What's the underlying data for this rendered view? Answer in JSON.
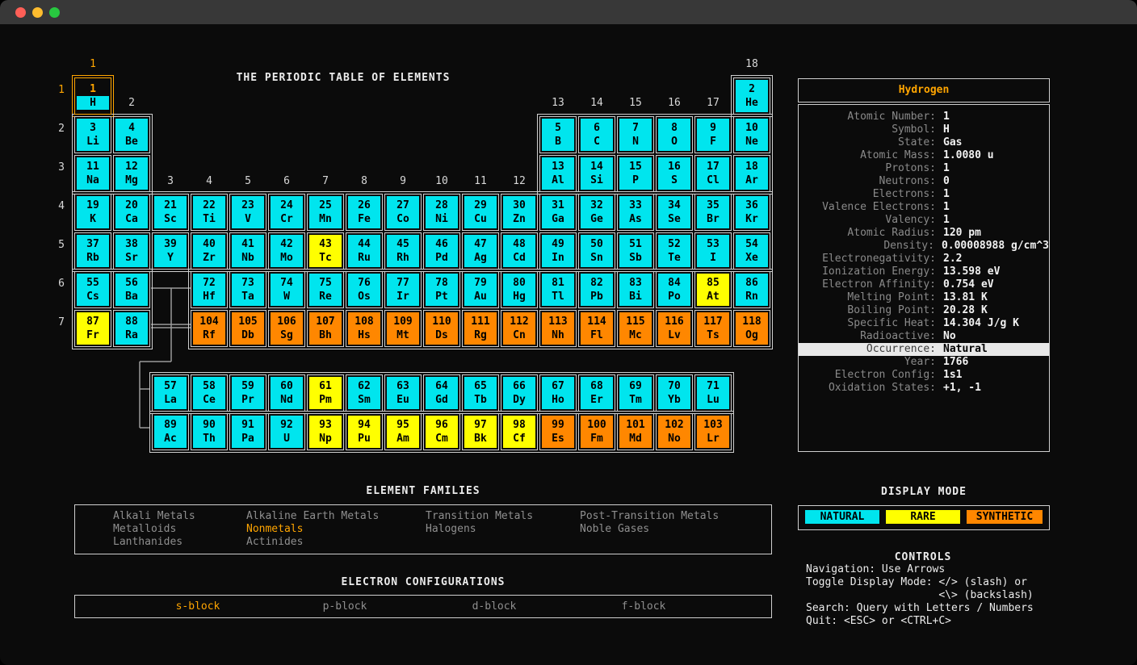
{
  "colors": {
    "natural": "#00e5ee",
    "rare": "#ffff00",
    "synthetic": "#ff8700",
    "accent": "#ffa500",
    "background": "#0b0b0b",
    "border": "#cfcfcf"
  },
  "table": {
    "title": "THE PERIODIC TABLE OF ELEMENTS",
    "selected_atomic_number": 1,
    "group_labels": [
      {
        "label": "1",
        "col": 1,
        "band": "top",
        "highlight": true
      },
      {
        "label": "2",
        "col": 2,
        "band": "row1"
      },
      {
        "label": "3",
        "col": 3,
        "band": "row3"
      },
      {
        "label": "4",
        "col": 4,
        "band": "row3"
      },
      {
        "label": "5",
        "col": 5,
        "band": "row3"
      },
      {
        "label": "6",
        "col": 6,
        "band": "row3"
      },
      {
        "label": "7",
        "col": 7,
        "band": "row3"
      },
      {
        "label": "8",
        "col": 8,
        "band": "row3"
      },
      {
        "label": "9",
        "col": 9,
        "band": "row3"
      },
      {
        "label": "10",
        "col": 10,
        "band": "row3"
      },
      {
        "label": "11",
        "col": 11,
        "band": "row3"
      },
      {
        "label": "12",
        "col": 12,
        "band": "row3"
      },
      {
        "label": "13",
        "col": 13,
        "band": "row1"
      },
      {
        "label": "14",
        "col": 14,
        "band": "row1"
      },
      {
        "label": "15",
        "col": 15,
        "band": "row1"
      },
      {
        "label": "16",
        "col": 16,
        "band": "row1"
      },
      {
        "label": "17",
        "col": 17,
        "band": "row1"
      },
      {
        "label": "18",
        "col": 18,
        "band": "top"
      }
    ],
    "period_labels": [
      {
        "label": "1",
        "highlight": true
      },
      {
        "label": "2"
      },
      {
        "label": "3"
      },
      {
        "label": "4"
      },
      {
        "label": "5"
      },
      {
        "label": "6"
      },
      {
        "label": "7"
      }
    ],
    "element_fields": [
      "atomic_number",
      "symbol",
      "grid_column",
      "grid_row",
      "occurrence(N=natural,R=rare,S=synthetic)"
    ],
    "elements": [
      [
        1,
        "H",
        1,
        1,
        "N"
      ],
      [
        2,
        "He",
        18,
        1,
        "N"
      ],
      [
        3,
        "Li",
        1,
        2,
        "N"
      ],
      [
        4,
        "Be",
        2,
        2,
        "N"
      ],
      [
        5,
        "B",
        13,
        2,
        "N"
      ],
      [
        6,
        "C",
        14,
        2,
        "N"
      ],
      [
        7,
        "N",
        15,
        2,
        "N"
      ],
      [
        8,
        "O",
        16,
        2,
        "N"
      ],
      [
        9,
        "F",
        17,
        2,
        "N"
      ],
      [
        10,
        "Ne",
        18,
        2,
        "N"
      ],
      [
        11,
        "Na",
        1,
        3,
        "N"
      ],
      [
        12,
        "Mg",
        2,
        3,
        "N"
      ],
      [
        13,
        "Al",
        13,
        3,
        "N"
      ],
      [
        14,
        "Si",
        14,
        3,
        "N"
      ],
      [
        15,
        "P",
        15,
        3,
        "N"
      ],
      [
        16,
        "S",
        16,
        3,
        "N"
      ],
      [
        17,
        "Cl",
        17,
        3,
        "N"
      ],
      [
        18,
        "Ar",
        18,
        3,
        "N"
      ],
      [
        19,
        "K",
        1,
        4,
        "N"
      ],
      [
        20,
        "Ca",
        2,
        4,
        "N"
      ],
      [
        21,
        "Sc",
        3,
        4,
        "N"
      ],
      [
        22,
        "Ti",
        4,
        4,
        "N"
      ],
      [
        23,
        "V",
        5,
        4,
        "N"
      ],
      [
        24,
        "Cr",
        6,
        4,
        "N"
      ],
      [
        25,
        "Mn",
        7,
        4,
        "N"
      ],
      [
        26,
        "Fe",
        8,
        4,
        "N"
      ],
      [
        27,
        "Co",
        9,
        4,
        "N"
      ],
      [
        28,
        "Ni",
        10,
        4,
        "N"
      ],
      [
        29,
        "Cu",
        11,
        4,
        "N"
      ],
      [
        30,
        "Zn",
        12,
        4,
        "N"
      ],
      [
        31,
        "Ga",
        13,
        4,
        "N"
      ],
      [
        32,
        "Ge",
        14,
        4,
        "N"
      ],
      [
        33,
        "As",
        15,
        4,
        "N"
      ],
      [
        34,
        "Se",
        16,
        4,
        "N"
      ],
      [
        35,
        "Br",
        17,
        4,
        "N"
      ],
      [
        36,
        "Kr",
        18,
        4,
        "N"
      ],
      [
        37,
        "Rb",
        1,
        5,
        "N"
      ],
      [
        38,
        "Sr",
        2,
        5,
        "N"
      ],
      [
        39,
        "Y",
        3,
        5,
        "N"
      ],
      [
        40,
        "Zr",
        4,
        5,
        "N"
      ],
      [
        41,
        "Nb",
        5,
        5,
        "N"
      ],
      [
        42,
        "Mo",
        6,
        5,
        "N"
      ],
      [
        43,
        "Tc",
        7,
        5,
        "R"
      ],
      [
        44,
        "Ru",
        8,
        5,
        "N"
      ],
      [
        45,
        "Rh",
        9,
        5,
        "N"
      ],
      [
        46,
        "Pd",
        10,
        5,
        "N"
      ],
      [
        47,
        "Ag",
        11,
        5,
        "N"
      ],
      [
        48,
        "Cd",
        12,
        5,
        "N"
      ],
      [
        49,
        "In",
        13,
        5,
        "N"
      ],
      [
        50,
        "Sn",
        14,
        5,
        "N"
      ],
      [
        51,
        "Sb",
        15,
        5,
        "N"
      ],
      [
        52,
        "Te",
        16,
        5,
        "N"
      ],
      [
        53,
        "I",
        17,
        5,
        "N"
      ],
      [
        54,
        "Xe",
        18,
        5,
        "N"
      ],
      [
        55,
        "Cs",
        1,
        6,
        "N"
      ],
      [
        56,
        "Ba",
        2,
        6,
        "N"
      ],
      [
        72,
        "Hf",
        4,
        6,
        "N"
      ],
      [
        73,
        "Ta",
        5,
        6,
        "N"
      ],
      [
        74,
        "W",
        6,
        6,
        "N"
      ],
      [
        75,
        "Re",
        7,
        6,
        "N"
      ],
      [
        76,
        "Os",
        8,
        6,
        "N"
      ],
      [
        77,
        "Ir",
        9,
        6,
        "N"
      ],
      [
        78,
        "Pt",
        10,
        6,
        "N"
      ],
      [
        79,
        "Au",
        11,
        6,
        "N"
      ],
      [
        80,
        "Hg",
        12,
        6,
        "N"
      ],
      [
        81,
        "Tl",
        13,
        6,
        "N"
      ],
      [
        82,
        "Pb",
        14,
        6,
        "N"
      ],
      [
        83,
        "Bi",
        15,
        6,
        "N"
      ],
      [
        84,
        "Po",
        16,
        6,
        "N"
      ],
      [
        85,
        "At",
        17,
        6,
        "R"
      ],
      [
        86,
        "Rn",
        18,
        6,
        "N"
      ],
      [
        87,
        "Fr",
        1,
        7,
        "R"
      ],
      [
        88,
        "Ra",
        2,
        7,
        "N"
      ],
      [
        104,
        "Rf",
        4,
        7,
        "S"
      ],
      [
        105,
        "Db",
        5,
        7,
        "S"
      ],
      [
        106,
        "Sg",
        6,
        7,
        "S"
      ],
      [
        107,
        "Bh",
        7,
        7,
        "S"
      ],
      [
        108,
        "Hs",
        8,
        7,
        "S"
      ],
      [
        109,
        "Mt",
        9,
        7,
        "S"
      ],
      [
        110,
        "Ds",
        10,
        7,
        "S"
      ],
      [
        111,
        "Rg",
        11,
        7,
        "S"
      ],
      [
        112,
        "Cn",
        12,
        7,
        "S"
      ],
      [
        113,
        "Nh",
        13,
        7,
        "S"
      ],
      [
        114,
        "Fl",
        14,
        7,
        "S"
      ],
      [
        115,
        "Mc",
        15,
        7,
        "S"
      ],
      [
        116,
        "Lv",
        16,
        7,
        "S"
      ],
      [
        117,
        "Ts",
        17,
        7,
        "S"
      ],
      [
        118,
        "Og",
        18,
        7,
        "S"
      ],
      [
        57,
        "La",
        3,
        8,
        "N"
      ],
      [
        58,
        "Ce",
        4,
        8,
        "N"
      ],
      [
        59,
        "Pr",
        5,
        8,
        "N"
      ],
      [
        60,
        "Nd",
        6,
        8,
        "N"
      ],
      [
        61,
        "Pm",
        7,
        8,
        "R"
      ],
      [
        62,
        "Sm",
        8,
        8,
        "N"
      ],
      [
        63,
        "Eu",
        9,
        8,
        "N"
      ],
      [
        64,
        "Gd",
        10,
        8,
        "N"
      ],
      [
        65,
        "Tb",
        11,
        8,
        "N"
      ],
      [
        66,
        "Dy",
        12,
        8,
        "N"
      ],
      [
        67,
        "Ho",
        13,
        8,
        "N"
      ],
      [
        68,
        "Er",
        14,
        8,
        "N"
      ],
      [
        69,
        "Tm",
        15,
        8,
        "N"
      ],
      [
        70,
        "Yb",
        16,
        8,
        "N"
      ],
      [
        71,
        "Lu",
        17,
        8,
        "N"
      ],
      [
        89,
        "Ac",
        3,
        9,
        "N"
      ],
      [
        90,
        "Th",
        4,
        9,
        "N"
      ],
      [
        91,
        "Pa",
        5,
        9,
        "N"
      ],
      [
        92,
        "U",
        6,
        9,
        "N"
      ],
      [
        93,
        "Np",
        7,
        9,
        "R"
      ],
      [
        94,
        "Pu",
        8,
        9,
        "R"
      ],
      [
        95,
        "Am",
        9,
        9,
        "R"
      ],
      [
        96,
        "Cm",
        10,
        9,
        "R"
      ],
      [
        97,
        "Bk",
        11,
        9,
        "R"
      ],
      [
        98,
        "Cf",
        12,
        9,
        "R"
      ],
      [
        99,
        "Es",
        13,
        9,
        "S"
      ],
      [
        100,
        "Fm",
        14,
        9,
        "S"
      ],
      [
        101,
        "Md",
        15,
        9,
        "S"
      ],
      [
        102,
        "No",
        16,
        9,
        "S"
      ],
      [
        103,
        "Lr",
        17,
        9,
        "S"
      ]
    ]
  },
  "panel": {
    "title": "Hydrogen",
    "rows": [
      {
        "label": "Atomic Number",
        "value": "1"
      },
      {
        "label": "Symbol",
        "value": "H"
      },
      {
        "label": "State",
        "value": "Gas"
      },
      {
        "label": "Atomic Mass",
        "value": "1.0080 u"
      },
      {
        "label": "Protons",
        "value": "1"
      },
      {
        "label": "Neutrons",
        "value": "0"
      },
      {
        "label": "Electrons",
        "value": "1"
      },
      {
        "label": "Valence Electrons",
        "value": "1"
      },
      {
        "label": "Valency",
        "value": "1"
      },
      {
        "label": "Atomic Radius",
        "value": "120 pm"
      },
      {
        "label": "Density",
        "value": "0.00008988 g/cm^3"
      },
      {
        "label": "Electronegativity",
        "value": "2.2"
      },
      {
        "label": "Ionization Energy",
        "value": "13.598 eV"
      },
      {
        "label": "Electron Affinity",
        "value": "0.754 eV"
      },
      {
        "label": "Melting Point",
        "value": "13.81 K"
      },
      {
        "label": "Boiling Point",
        "value": "20.28 K"
      },
      {
        "label": "Specific Heat",
        "value": "14.304 J/g K"
      },
      {
        "label": "Radioactive",
        "value": "No"
      },
      {
        "label": "Occurrence",
        "value": "Natural",
        "highlight": true
      },
      {
        "label": "Year",
        "value": "1766"
      },
      {
        "label": "Electron Config",
        "value": "1s1"
      },
      {
        "label": "Oxidation States",
        "value": "+1, -1"
      }
    ]
  },
  "families": {
    "title": "ELEMENT FAMILIES",
    "active": "Nonmetals",
    "rows": [
      [
        "Alkali Metals",
        "Alkaline Earth Metals",
        "Transition Metals",
        "Post-Transition Metals"
      ],
      [
        "Metalloids",
        "Nonmetals",
        "Halogens",
        "Noble Gases"
      ],
      [
        "Lanthanides",
        "Actinides"
      ]
    ]
  },
  "configs": {
    "title": "ELECTRON CONFIGURATIONS",
    "active": "s-block",
    "items": [
      "s-block",
      "p-block",
      "d-block",
      "f-block"
    ]
  },
  "display_mode": {
    "title": "DISPLAY MODE",
    "modes": [
      {
        "label": "NATURAL",
        "color_key": "natural"
      },
      {
        "label": "RARE",
        "color_key": "rare"
      },
      {
        "label": "SYNTHETIC",
        "color_key": "synthetic"
      }
    ]
  },
  "controls": {
    "title": "CONTROLS",
    "lines": [
      "Navigation: Use Arrows",
      "Toggle Display Mode: </> (slash) or",
      "                     <\\> (backslash)",
      "Search: Query with Letters / Numbers",
      "Quit: <ESC> or <CTRL+C>"
    ]
  }
}
